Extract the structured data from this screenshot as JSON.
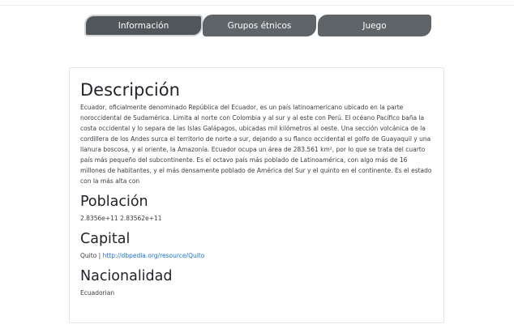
{
  "tabs": [
    {
      "label": "Información"
    },
    {
      "label": "Grupos étnicos"
    },
    {
      "label": "Juego"
    }
  ],
  "descripcion": {
    "title": "Descripción",
    "text": "Ecuador, oficialmente denominado República del Ecuador, es un país latinoamericano ubicado en la parte noroccidental de Sudamérica. Limita al norte con Colombia y al sur y al este con Perú. El océano Pacífico baña la costa occidental y lo separa de las Islas Galápagos, ubicadas mil kilómetros al oeste. Una sección volcánica de la cordillera de los Andes surca el territorio de norte a sur, dejando a su flanco occidental el golfo de Guayaquil y una llanura boscosa, y al oriente, la Amazonía. Ecuador ocupa un área de 283.561 km², por lo que se trata del cuarto país más pequeño del subcontinente. Es el octavo país más poblado de Latinoamérica, con algo más de 16 millones de habitantes, y el más densamente poblado de América del Sur y el quinto en el continente. Es el estado con la más alta con"
  },
  "poblacion": {
    "title": "Población",
    "text": "2.8356e+11 2.83562e+11"
  },
  "capital": {
    "title": "Capital",
    "name": "Quito",
    "separator": " | ",
    "link": "http://dbpedia.org/resource/Quito"
  },
  "nacionalidad": {
    "title": "Nacionalidad",
    "text": "Ecuadorian"
  }
}
